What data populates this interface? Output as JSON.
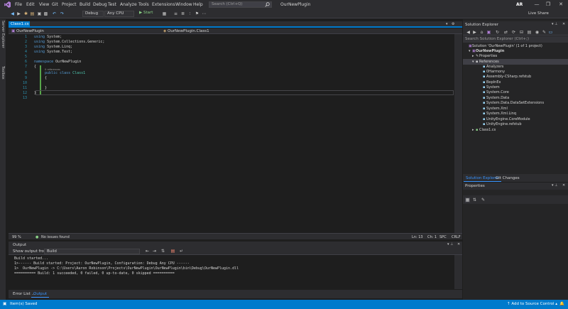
{
  "menu": {
    "items": [
      "File",
      "Edit",
      "View",
      "Git",
      "Project",
      "Build",
      "Debug",
      "Test",
      "Analyze",
      "Tools",
      "Extensions",
      "Window",
      "Help"
    ],
    "search_placeholder": "Search (Ctrl+Q)",
    "solution_name": "OurNewPlugin",
    "user_initials": "AR",
    "window_controls": [
      "—",
      "❐",
      "✕"
    ]
  },
  "toolbar": {
    "configuration": "Debug",
    "platform": "Any CPU",
    "start_label": "▶ Start",
    "live_share_label": "Live Share"
  },
  "left_rail": {
    "items": [
      "Server Explorer",
      "Toolbox"
    ]
  },
  "editor": {
    "tab_label": "Class1.cs",
    "nav_project": "OurNewPlugin",
    "nav_class": "OurNewPlugin.Class1",
    "line_numbers": [
      "1",
      "2",
      "3",
      "4",
      "5",
      "6",
      "7",
      "8",
      "9",
      "10",
      "11",
      "12",
      "13"
    ],
    "code": {
      "l1_kw": "using",
      "l1_rest": " System;",
      "l2_kw": "using",
      "l2_rest": " System.Collections.Generic;",
      "l3_kw": "using",
      "l3_rest": " System.Linq;",
      "l4_kw": "using",
      "l4_rest": " System.Text;",
      "l6_kw": "namespace",
      "l6_rest": " OurNewPlugin",
      "l7": "{",
      "refs": "0 references",
      "l8_kw": "public class",
      "l8_type": " Class1",
      "l9": "{",
      "l11": "}",
      "l12": "}"
    },
    "zoom": "99 %",
    "issues": "No issues found",
    "line": "Ln: 13",
    "col": "Ch: 1",
    "spc": "SPC",
    "eol": "CRLF"
  },
  "output": {
    "title": "Output",
    "show_from_label": "Show output from:",
    "show_from_value": "Build",
    "lines": [
      "Build started...",
      "1>------ Build started: Project: OurNewPlugin, Configuration: Debug Any CPU ------",
      "1>  OurNewPlugin -> C:\\Users\\Aaron Robinson\\Projects\\OurNewPlugin\\OurNewPlugin\\bin\\Debug\\OurNewPlugin.dll",
      "========== Build: 1 succeeded, 0 failed, 0 up-to-date, 0 skipped =========="
    ],
    "tabs": [
      "Error List ...",
      "Output"
    ]
  },
  "solution_explorer": {
    "title": "Solution Explorer",
    "search_placeholder": "Search Solution Explorer (Ctrl+;)",
    "solution_label": "Solution 'OurNewPlugin' (1 of 1 project)",
    "project_label": "OurNewPlugin",
    "properties_label": "Properties",
    "references_label": "References",
    "references": [
      "Analyzers",
      "0Harmony",
      "Assembly-CSharp.refstub",
      "BepInEx",
      "System",
      "System.Core",
      "System.Data",
      "System.Data.DataSetExtensions",
      "System.Xml",
      "System.Xml.Linq",
      "UnityEngine.CoreModule",
      "UnityEngine.refstub"
    ],
    "class_file": "Class1.cs",
    "tabs": [
      "Solution Explorer",
      "Git Changes"
    ]
  },
  "properties": {
    "title": "Properties"
  },
  "statusbar": {
    "left": "Item(s) Saved",
    "source_control": "Add to Source Control"
  },
  "colors": {
    "accent": "#007acc",
    "background": "#1e1e1e",
    "chrome": "#2d2d30",
    "keyword": "#569cd6",
    "type": "#4ec9b0",
    "line_number": "#2b91af"
  }
}
